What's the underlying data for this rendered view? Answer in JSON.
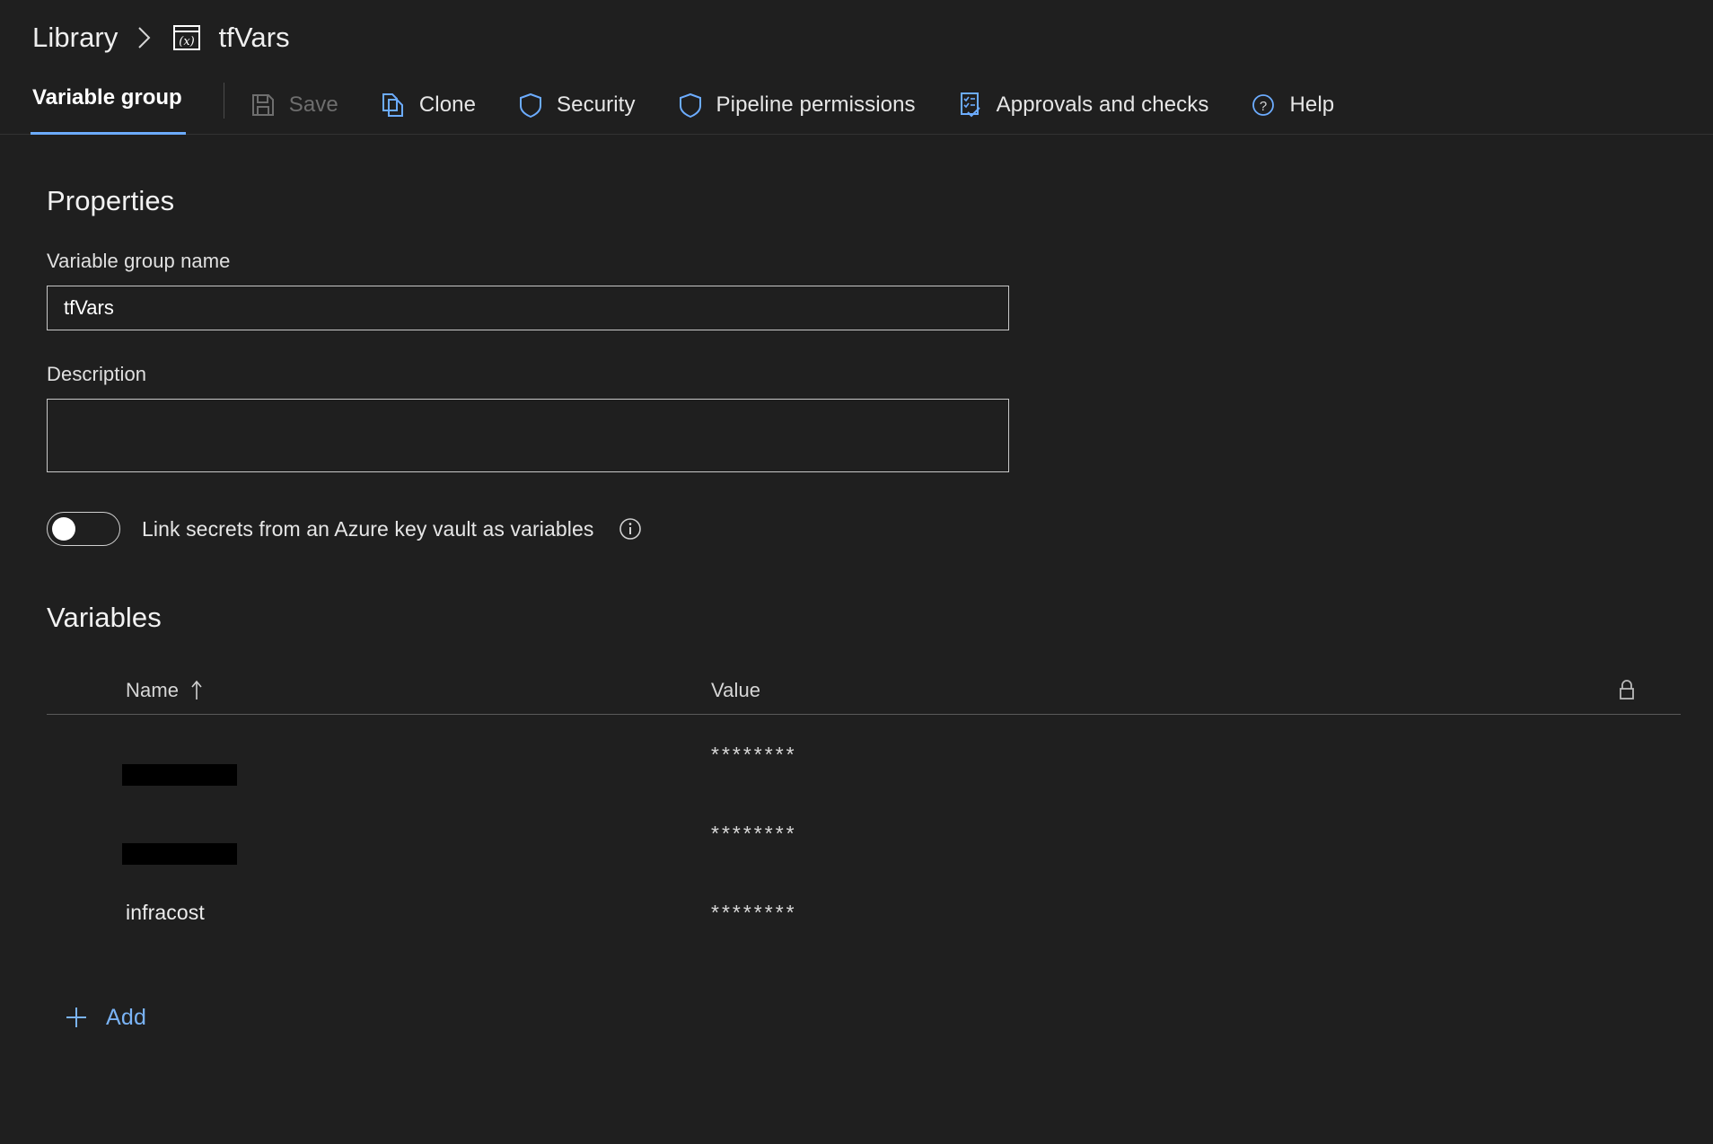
{
  "breadcrumb": {
    "root_label": "Library",
    "separator_icon": "chevron-right-icon",
    "group_icon": "variable-group-icon",
    "current_label": "tfVars"
  },
  "toolbar": {
    "active_tab": "Variable group",
    "items": [
      {
        "label": "Save",
        "icon": "save-icon",
        "disabled": true
      },
      {
        "label": "Clone",
        "icon": "clone-icon",
        "disabled": false
      },
      {
        "label": "Security",
        "icon": "shield-icon",
        "disabled": false
      },
      {
        "label": "Pipeline permissions",
        "icon": "shield-icon",
        "disabled": false
      },
      {
        "label": "Approvals and checks",
        "icon": "checklist-icon",
        "disabled": false
      },
      {
        "label": "Help",
        "icon": "help-circle-icon",
        "disabled": false
      }
    ]
  },
  "properties": {
    "heading": "Properties",
    "name_label": "Variable group name",
    "name_value": "tfVars",
    "name_placeholder": "",
    "description_label": "Description",
    "description_value": "",
    "description_placeholder": "",
    "keyvault_toggle_label": "Link secrets from an Azure key vault as variables",
    "keyvault_toggle_state": "off",
    "info_icon": "info-icon"
  },
  "variables": {
    "heading": "Variables",
    "columns": {
      "name": "Name",
      "value": "Value",
      "lock_icon": "lock-icon",
      "sort_icon": "sort-ascending-arrow-icon"
    },
    "rows": [
      {
        "name": "",
        "name_redacted": true,
        "redaction_width": 128,
        "value": "********"
      },
      {
        "name": "",
        "name_redacted": true,
        "redaction_width": 128,
        "value": "********"
      },
      {
        "name": "infracost",
        "name_redacted": false,
        "redaction_width": 0,
        "value": "********"
      }
    ],
    "add_label": "Add",
    "add_icon": "plus-icon"
  },
  "colors": {
    "background": "#1f1f1f",
    "accent_blue": "#6cacff",
    "link_blue": "#7ab3f5",
    "text_primary": "#efefef",
    "text_disabled": "#6e6e6e",
    "divider": "#5a5a5a",
    "redaction": "#000000"
  }
}
